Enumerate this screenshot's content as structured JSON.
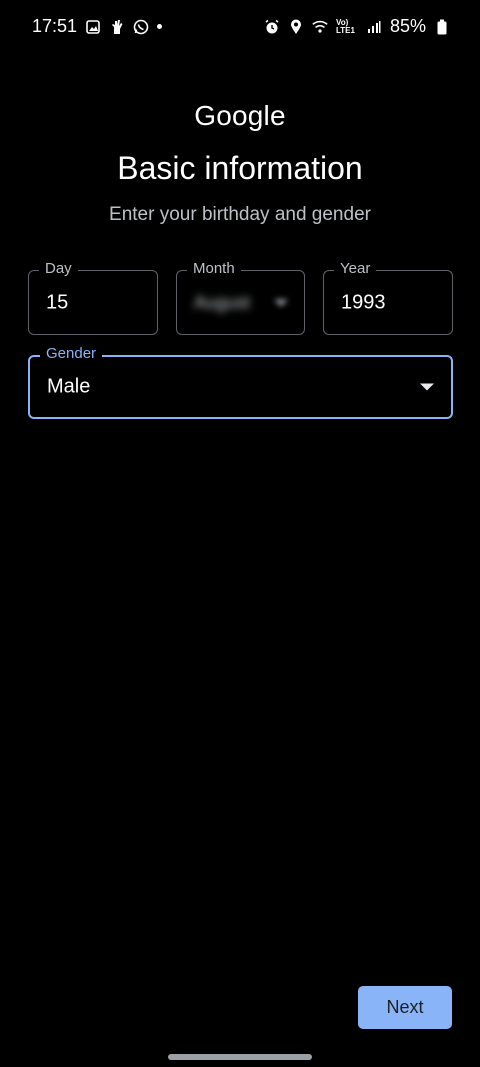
{
  "status_bar": {
    "time": "17:51",
    "battery": "85%",
    "left_icons": [
      "image-icon",
      "hand-gesture-icon",
      "whatsapp-icon",
      "dot-icon"
    ],
    "right_icons": [
      "alarm-icon",
      "location-icon",
      "wifi-icon",
      "volte-lte-icon",
      "signal-icon",
      "battery-icon"
    ],
    "network_label": "Vo) LTE1"
  },
  "header": {
    "brand": "Google",
    "title": "Basic information",
    "subtitle": "Enter your birthday and gender"
  },
  "form": {
    "day": {
      "label": "Day",
      "value": "15"
    },
    "month": {
      "label": "Month",
      "value": "August"
    },
    "year": {
      "label": "Year",
      "value": "1993"
    },
    "gender": {
      "label": "Gender",
      "value": "Male"
    }
  },
  "actions": {
    "next_label": "Next"
  },
  "colors": {
    "accent": "#8ab4f8",
    "background": "#000000",
    "border": "#5f6368"
  }
}
